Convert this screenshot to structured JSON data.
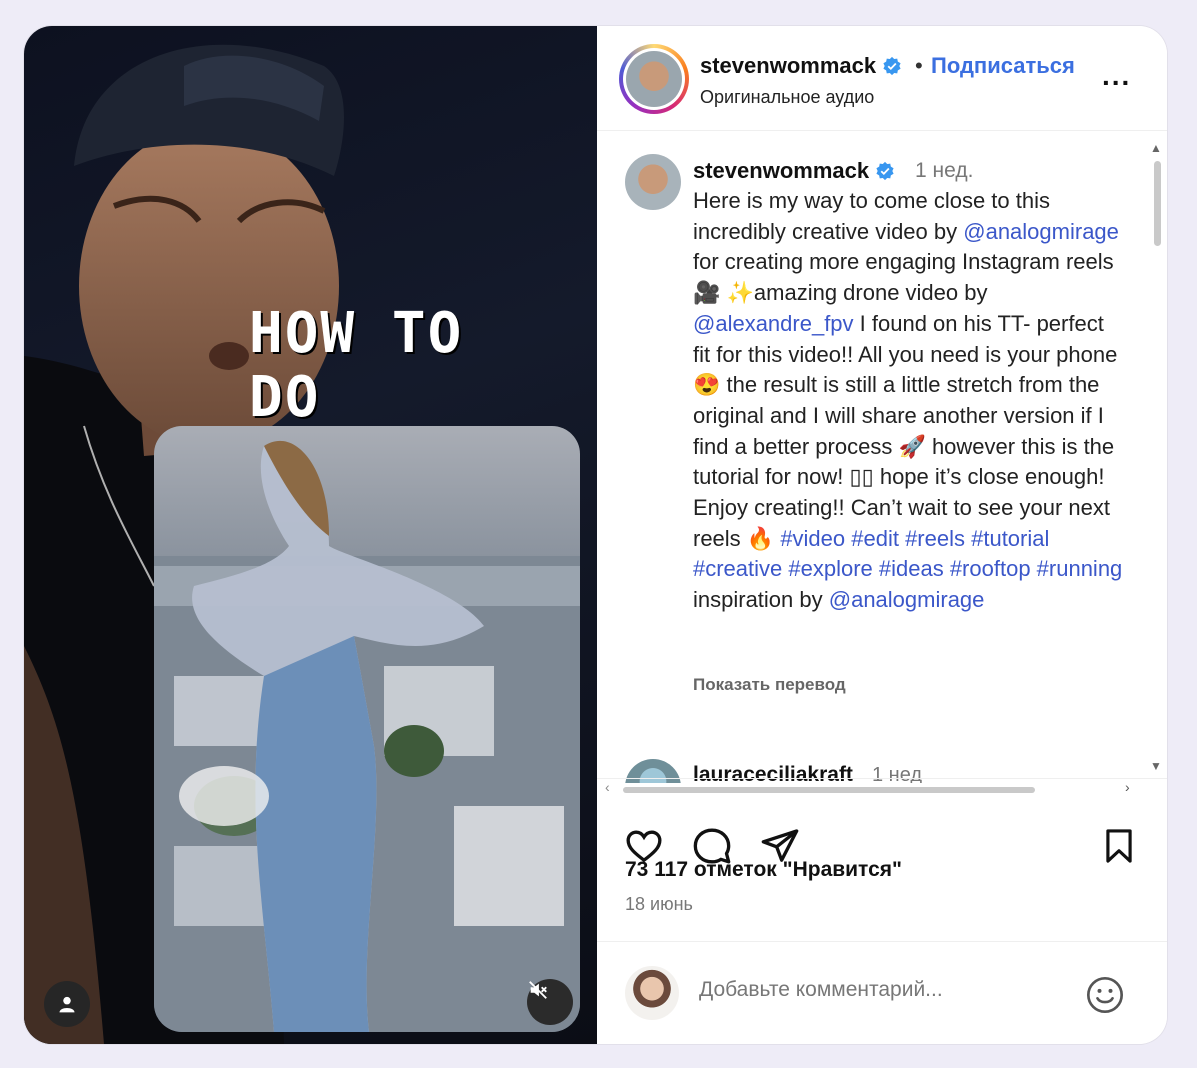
{
  "media": {
    "overlay_line1": "HOW TO",
    "overlay_line2": "DO THIS..."
  },
  "header": {
    "username": "stevenwommack",
    "dot": "•",
    "follow_label": "Подписаться",
    "audio_label": "Оригинальное аудио",
    "more_label": "..."
  },
  "post": {
    "username": "stevenwommack",
    "time": "1 нед.",
    "caption_parts": {
      "p1": "Here is my way to come close to this incredibly creative video by ",
      "m1": "@analogmirage",
      "p2": " for creating more engaging Instagram reels 🎥 ✨amazing drone video by ",
      "m2": "@alexandre_fpv",
      "p3": " I found on his TT- perfect fit for this video!! All you need is your phone 😍 the result is still a little stretch from the original and I will share another version if I find a better process 🚀 however this is the tutorial for now! ▯▯ hope it’s close enough! Enjoy creating!! Can’t wait to see your next reels 🔥 ",
      "tags": "#video #edit #reels #tutorial #creative #explore #ideas #rooftop #running",
      "p4": " inspiration by ",
      "m3": "@analogmirage"
    },
    "translate_label": "Показать перевод"
  },
  "next_comment": {
    "username": "lauraceciliakraft",
    "time": "1 нед"
  },
  "stats": {
    "likes": "73 117 отметок \"Нравится\"",
    "date": "18 июнь"
  },
  "comment_box": {
    "placeholder": "Добавьте комментарий..."
  },
  "icons": [
    "heart-icon",
    "comment-icon",
    "share-icon",
    "bookmark-icon",
    "emoji-icon",
    "user-icon",
    "mute-icon",
    "verified-icon"
  ],
  "colors": {
    "link": "#3b57c9",
    "follow": "#3b6fe0",
    "verified": "#3897f0"
  }
}
